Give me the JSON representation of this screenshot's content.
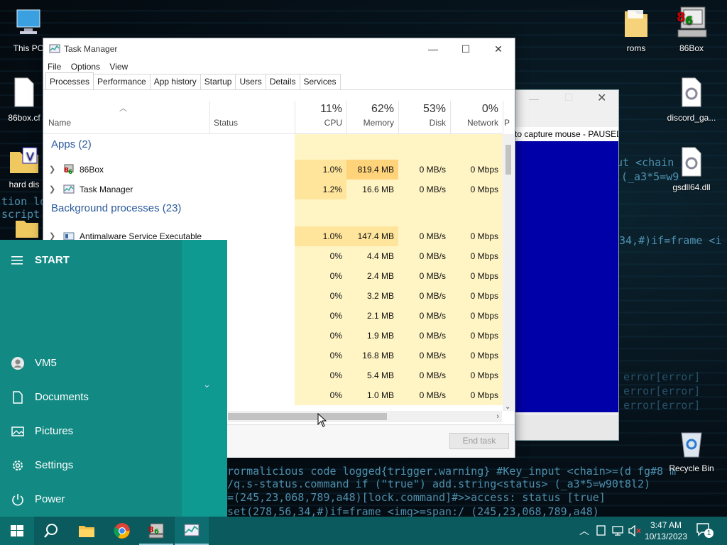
{
  "desktop": {
    "icons_left": [
      {
        "label": "This PC"
      },
      {
        "label": "86box.cf"
      },
      {
        "label": "hard dis"
      }
    ],
    "icons_right": [
      {
        "label": "roms"
      },
      {
        "label": "86Box"
      },
      {
        "label": "discord_ga..."
      },
      {
        "label": "gsdll64.dll"
      },
      {
        "label": "Recycle Bin"
      }
    ],
    "background_text": [
      "ut <chain",
      "(_a3*5=w9",
      "34,#)if=frame <i",
      "error[error]",
      "error[error]",
      "error[error]",
      "rormalicious code logged{trigger.warning} #Key_input <chain>=(d fg#8 m",
      "/q.s-status.command if (\"true\") add.string<status> (_a3*5=w90t8l2)",
      "=(245,23,068,789,a48)[lock.command]#>>access: status [true]",
      "set(278,56,34,#)if=frame <img>=span:/ (245,23,068,789,a48)",
      "tion log",
      "script s"
    ]
  },
  "background_window": {
    "message": "to capture mouse - PAUSED"
  },
  "task_manager": {
    "title": "Task Manager",
    "menu": [
      "File",
      "Options",
      "View"
    ],
    "tabs": [
      "Processes",
      "Performance",
      "App history",
      "Startup",
      "Users",
      "Details",
      "Services"
    ],
    "columns": {
      "name": "Name",
      "status": "Status",
      "cpu": {
        "pct": "11%",
        "label": "CPU"
      },
      "memory": {
        "pct": "62%",
        "label": "Memory"
      },
      "disk": {
        "pct": "53%",
        "label": "Disk"
      },
      "network": {
        "pct": "0%",
        "label": "Network"
      },
      "overflow": "P"
    },
    "apps_group": "Apps (2)",
    "apps": [
      {
        "name": "86Box",
        "cpu": "1.0%",
        "mem": "819.4 MB",
        "disk": "0 MB/s",
        "net": "0 Mbps"
      },
      {
        "name": "Task Manager",
        "cpu": "1.2%",
        "mem": "16.6 MB",
        "disk": "0 MB/s",
        "net": "0 Mbps"
      }
    ],
    "bg_group": "Background processes (23)",
    "bg": [
      {
        "name": "Antimalware Service Executable",
        "cpu": "1.0%",
        "mem": "147.4 MB",
        "disk": "0 MB/s",
        "net": "0 Mbps"
      },
      {
        "name": "",
        "cpu": "0%",
        "mem": "4.4 MB",
        "disk": "0 MB/s",
        "net": "0 Mbps"
      },
      {
        "name": "",
        "cpu": "0%",
        "mem": "2.4 MB",
        "disk": "0 MB/s",
        "net": "0 Mbps"
      },
      {
        "name": "",
        "cpu": "0%",
        "mem": "3.2 MB",
        "disk": "0 MB/s",
        "net": "0 Mbps"
      },
      {
        "name": "",
        "cpu": "0%",
        "mem": "2.1 MB",
        "disk": "0 MB/s",
        "net": "0 Mbps"
      },
      {
        "name": "",
        "cpu": "0%",
        "mem": "1.9 MB",
        "disk": "0 MB/s",
        "net": "0 Mbps"
      },
      {
        "name": "",
        "cpu": "0%",
        "mem": "16.8 MB",
        "disk": "0 MB/s",
        "net": "0 Mbps"
      },
      {
        "name": "",
        "cpu": "0%",
        "mem": "5.4 MB",
        "disk": "0 MB/s",
        "net": "0 Mbps"
      },
      {
        "name": "",
        "cpu": "0%",
        "mem": "1.0 MB",
        "disk": "0 MB/s",
        "net": "0 Mbps"
      }
    ],
    "end_task": "End task"
  },
  "start_menu": {
    "header": "START",
    "items": [
      {
        "label": "VM5",
        "icon": "user-icon"
      },
      {
        "label": "Documents",
        "icon": "document-icon"
      },
      {
        "label": "Pictures",
        "icon": "pictures-icon"
      },
      {
        "label": "Settings",
        "icon": "gear-icon"
      },
      {
        "label": "Power",
        "icon": "power-icon"
      }
    ]
  },
  "taskbar": {
    "time": "3:47 AM",
    "date": "10/13/2023",
    "notification_count": "1"
  },
  "colors": {
    "start_bg": "#128a83",
    "taskbar_bg": "#0a5a5e",
    "link_blue": "#2a5a9c",
    "heat_low": "#fff4c4",
    "heat_mid": "#ffe59c",
    "heat_high": "#ffd37a"
  }
}
